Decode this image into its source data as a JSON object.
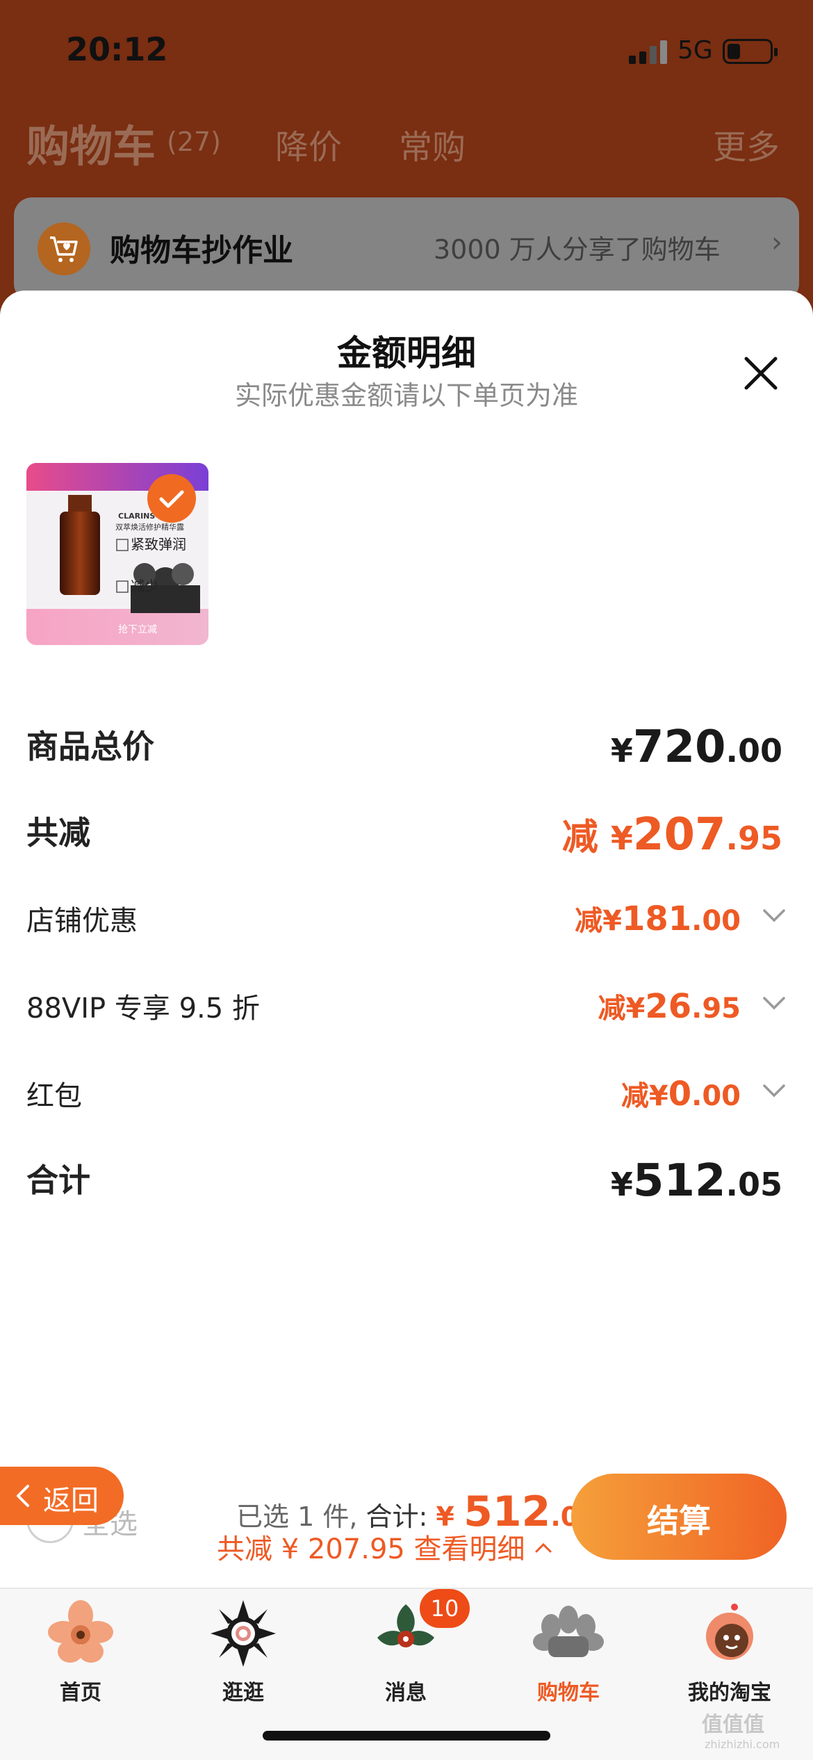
{
  "status_bar": {
    "time": "20:12",
    "network": "5G"
  },
  "cart_header": {
    "title": "购物车",
    "count": "(27)",
    "tabs": [
      "降价",
      "常购"
    ],
    "more": "更多"
  },
  "homework_banner": {
    "title": "购物车抄作业",
    "subtitle": "3000 万人分享了购物车",
    "icon": "cart-heart-icon"
  },
  "sheet": {
    "title": "金额明细",
    "subtitle": "实际优惠金额请以下单页为准",
    "product": {
      "brand_text": "CLARINS",
      "name_text": "双萃焕活修护精华露",
      "feature_1": "紧致弹润",
      "feature_2": "减少",
      "cta": "抢下立减",
      "selected": true
    },
    "rows": [
      {
        "label": "商品总价",
        "prefix": "",
        "currency": "¥",
        "int": "720",
        "dec": ".00"
      },
      {
        "label": "共减",
        "prefix": "减 ",
        "currency": "¥",
        "int": "207",
        "dec": ".95"
      },
      {
        "label": "店铺优惠",
        "prefix": "减",
        "currency": "¥",
        "int": "181",
        "dec": ".00"
      },
      {
        "label": "88VIP 专享 9.5 折",
        "prefix": "减",
        "currency": "¥",
        "int": "26",
        "dec": ".95"
      },
      {
        "label": "红包",
        "prefix": "减",
        "currency": "¥",
        "int": "0",
        "dec": ".00"
      },
      {
        "label": "合计",
        "prefix": "",
        "currency": "¥",
        "int": "512",
        "dec": ".05"
      }
    ]
  },
  "bottom_bar": {
    "back_label": "返回",
    "select_all_label": "全选",
    "selected_info": "已选 1 件,",
    "total_label": "合计:",
    "total_currency": "¥ ",
    "total_int": "512",
    "total_dec": ".05",
    "savings_line": "共减 ¥ 207.95  查看明细",
    "checkout_label": "结算"
  },
  "tabbar": [
    {
      "label": "首页",
      "icon": "home-flower-icon"
    },
    {
      "label": "逛逛",
      "icon": "browse-flower-icon"
    },
    {
      "label": "消息",
      "icon": "message-leaf-icon",
      "badge": "10"
    },
    {
      "label": "购物车",
      "icon": "cart-flower-icon",
      "active": true
    },
    {
      "label": "我的淘宝",
      "icon": "my-taobao-icon"
    }
  ],
  "watermark": {
    "text": "值值值",
    "domain": "zhizhizhi.com"
  },
  "colors": {
    "accent": "#ee5a24",
    "header_bg": "#7a2e12",
    "checkout_start": "#f5a03a",
    "checkout_end": "#f06325"
  }
}
